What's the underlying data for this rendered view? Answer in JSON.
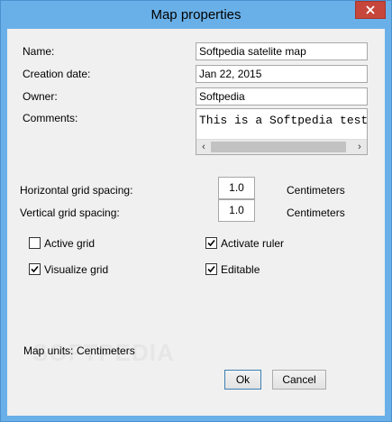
{
  "window": {
    "title": "Map properties"
  },
  "fields": {
    "name": {
      "label": "Name:",
      "value": "Softpedia satelite map"
    },
    "creation_date": {
      "label": "Creation date:",
      "value": "Jan 22, 2015"
    },
    "owner": {
      "label": "Owner:",
      "value": "Softpedia"
    },
    "comments": {
      "label": "Comments:",
      "value": "This is a Softpedia test"
    }
  },
  "grid": {
    "horizontal": {
      "label": "Horizontal grid spacing:",
      "value": "1.0",
      "unit": "Centimeters"
    },
    "vertical": {
      "label": "Vertical grid spacing:",
      "value": "1.0",
      "unit": "Centimeters"
    }
  },
  "checkboxes": {
    "active_grid": {
      "label": "Active grid",
      "checked": false
    },
    "activate_ruler": {
      "label": "Activate ruler",
      "checked": true
    },
    "visualize_grid": {
      "label": "Visualize grid",
      "checked": true
    },
    "editable": {
      "label": "Editable",
      "checked": true
    }
  },
  "units": {
    "label": "Map units:",
    "value": "Centimeters"
  },
  "buttons": {
    "ok": "Ok",
    "cancel": "Cancel"
  },
  "watermark": "SOFTPEDIA"
}
